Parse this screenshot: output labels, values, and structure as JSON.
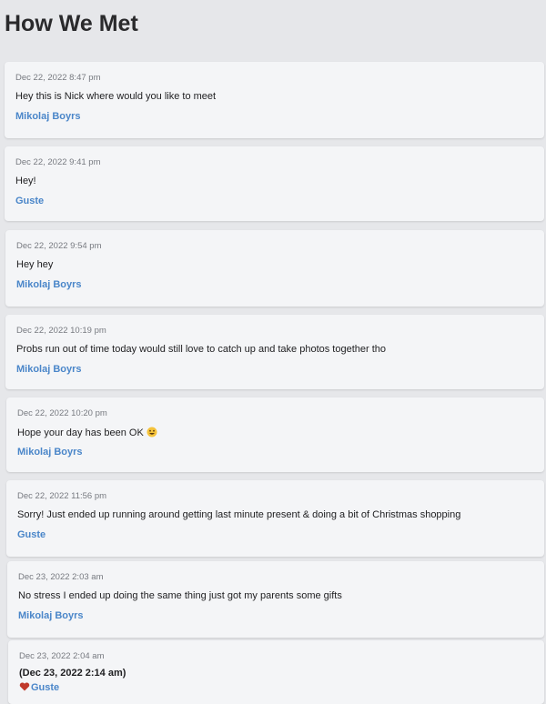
{
  "page": {
    "title": "How We Met"
  },
  "messages": [
    {
      "timestamp": "Dec 22, 2022 8:47 pm",
      "text": "Hey this is Nick where would you like to meet",
      "author": "Mikolaj Boyrs"
    },
    {
      "timestamp": "Dec 22, 2022 9:41 pm",
      "text": "Hey!",
      "author": "Guste"
    },
    {
      "timestamp": "Dec 22, 2022 9:54 pm",
      "text": "Hey hey",
      "author": "Mikolaj Boyrs"
    },
    {
      "timestamp": "Dec 22, 2022 10:19 pm",
      "text": "Probs run out of time today would still love to catch up and take photos together tho",
      "author": "Mikolaj Boyrs"
    },
    {
      "timestamp": "Dec 22, 2022 10:20 pm",
      "text": "Hope your day has been OK",
      "author": "Mikolaj Boyrs",
      "emoji": "grinning-face-icon"
    },
    {
      "timestamp": "Dec 22, 2022 11:56 pm",
      "text": "Sorry! Just ended up running around getting last minute present & doing a bit of Christmas shopping",
      "author": "Guste"
    },
    {
      "timestamp": "Dec 23, 2022 2:03 am",
      "text": "No stress I ended up doing the same thing just got my parents some gifts",
      "author": "Mikolaj Boyrs"
    },
    {
      "timestamp": "Dec 23, 2022 2:04 am",
      "text": "(Dec 23, 2022 2:14 am)",
      "author": "Guste",
      "author_icon": "heart-icon"
    }
  ],
  "colors": {
    "author": "#4a86c9",
    "background": "#e6e7ea",
    "card": "#f4f5f7",
    "heart": "#c0392b"
  }
}
